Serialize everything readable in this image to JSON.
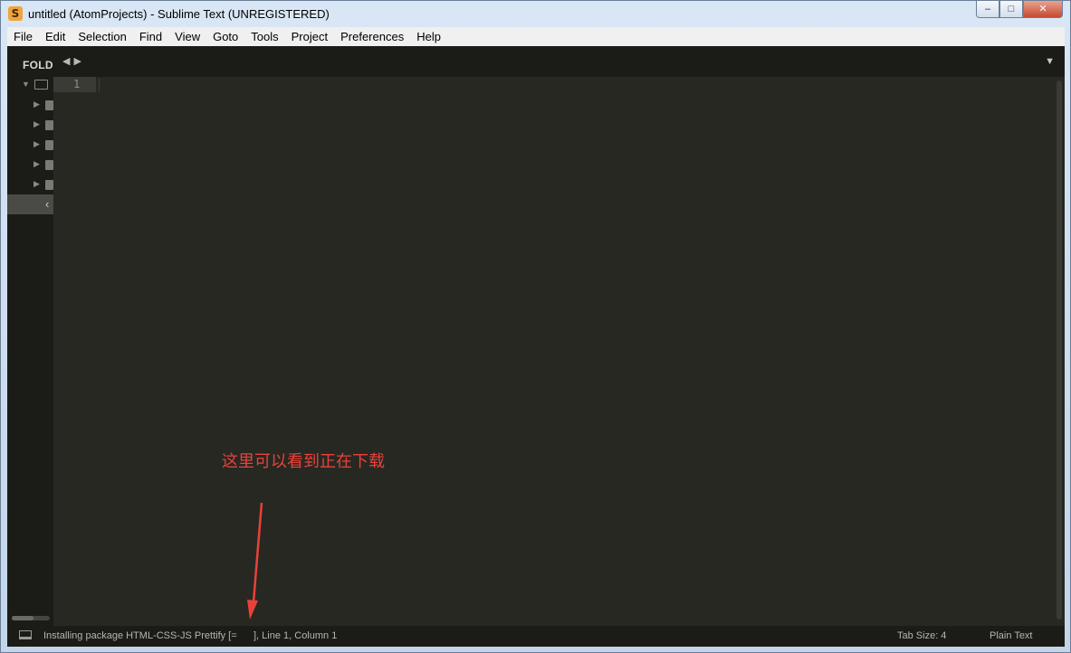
{
  "window": {
    "title": "untitled (AtomProjects) - Sublime Text (UNREGISTERED)",
    "app_icon_glyph": "S",
    "minimize_glyph": "–",
    "maximize_glyph": "□",
    "close_glyph": "✕"
  },
  "menu": [
    "File",
    "Edit",
    "Selection",
    "Find",
    "View",
    "Goto",
    "Tools",
    "Project",
    "Preferences",
    "Help"
  ],
  "sidebar": {
    "header": "FOLD",
    "collapse_glyph": "‹"
  },
  "tabbar": {
    "nav_glyph": "◀▶",
    "dropdown_glyph": "▼"
  },
  "editor": {
    "line_number": "1"
  },
  "annotation": {
    "text": "这里可以看到正在下载",
    "color": "#e8423a"
  },
  "statusbar": {
    "message": "Installing package HTML-CSS-JS Prettify [=      ], Line 1, Column 1",
    "tab_size": "Tab Size: 4",
    "syntax": "Plain Text"
  },
  "icons": {
    "status_panel": "panel-toggle-icon",
    "folder": "folder-icon"
  }
}
